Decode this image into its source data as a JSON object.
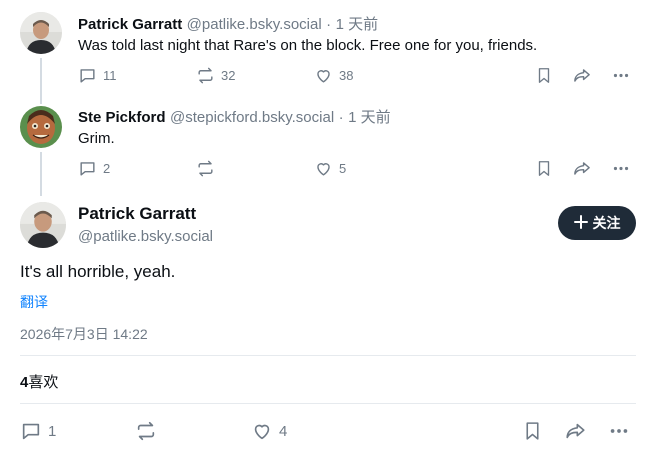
{
  "posts": [
    {
      "author_name": "Patrick Garratt",
      "author_handle": "@patlike.bsky.social",
      "separator": "·",
      "time_ago": "1 天前",
      "text": "Was told last night that Rare's on the block. Free one for you, friends.",
      "reply_count": "11",
      "repost_count": "32",
      "like_count": "38"
    },
    {
      "author_name": "Ste Pickford",
      "author_handle": "@stepickford.bsky.social",
      "separator": "·",
      "time_ago": "1 天前",
      "text": "Grim.",
      "reply_count": "2",
      "repost_count": "",
      "like_count": "5"
    }
  ],
  "focused_post": {
    "author_name": "Patrick Garratt",
    "author_handle": "@patlike.bsky.social",
    "follow_label": "关注",
    "text": "It's all horrible, yeah.",
    "translate_label": "翻译",
    "datetime": "2026年7月3日 14:22",
    "like_count_number": "4",
    "like_count_label": "喜欢",
    "reply_count": "1",
    "like_count": "4"
  },
  "icons": [
    "reply-icon",
    "repost-icon",
    "like-icon",
    "bookmark-icon",
    "share-icon",
    "more-icon",
    "plus-icon"
  ],
  "colors": {
    "accent": "#1083fe",
    "muted": "#6f7a86",
    "follow_button": "#1f2b38"
  }
}
